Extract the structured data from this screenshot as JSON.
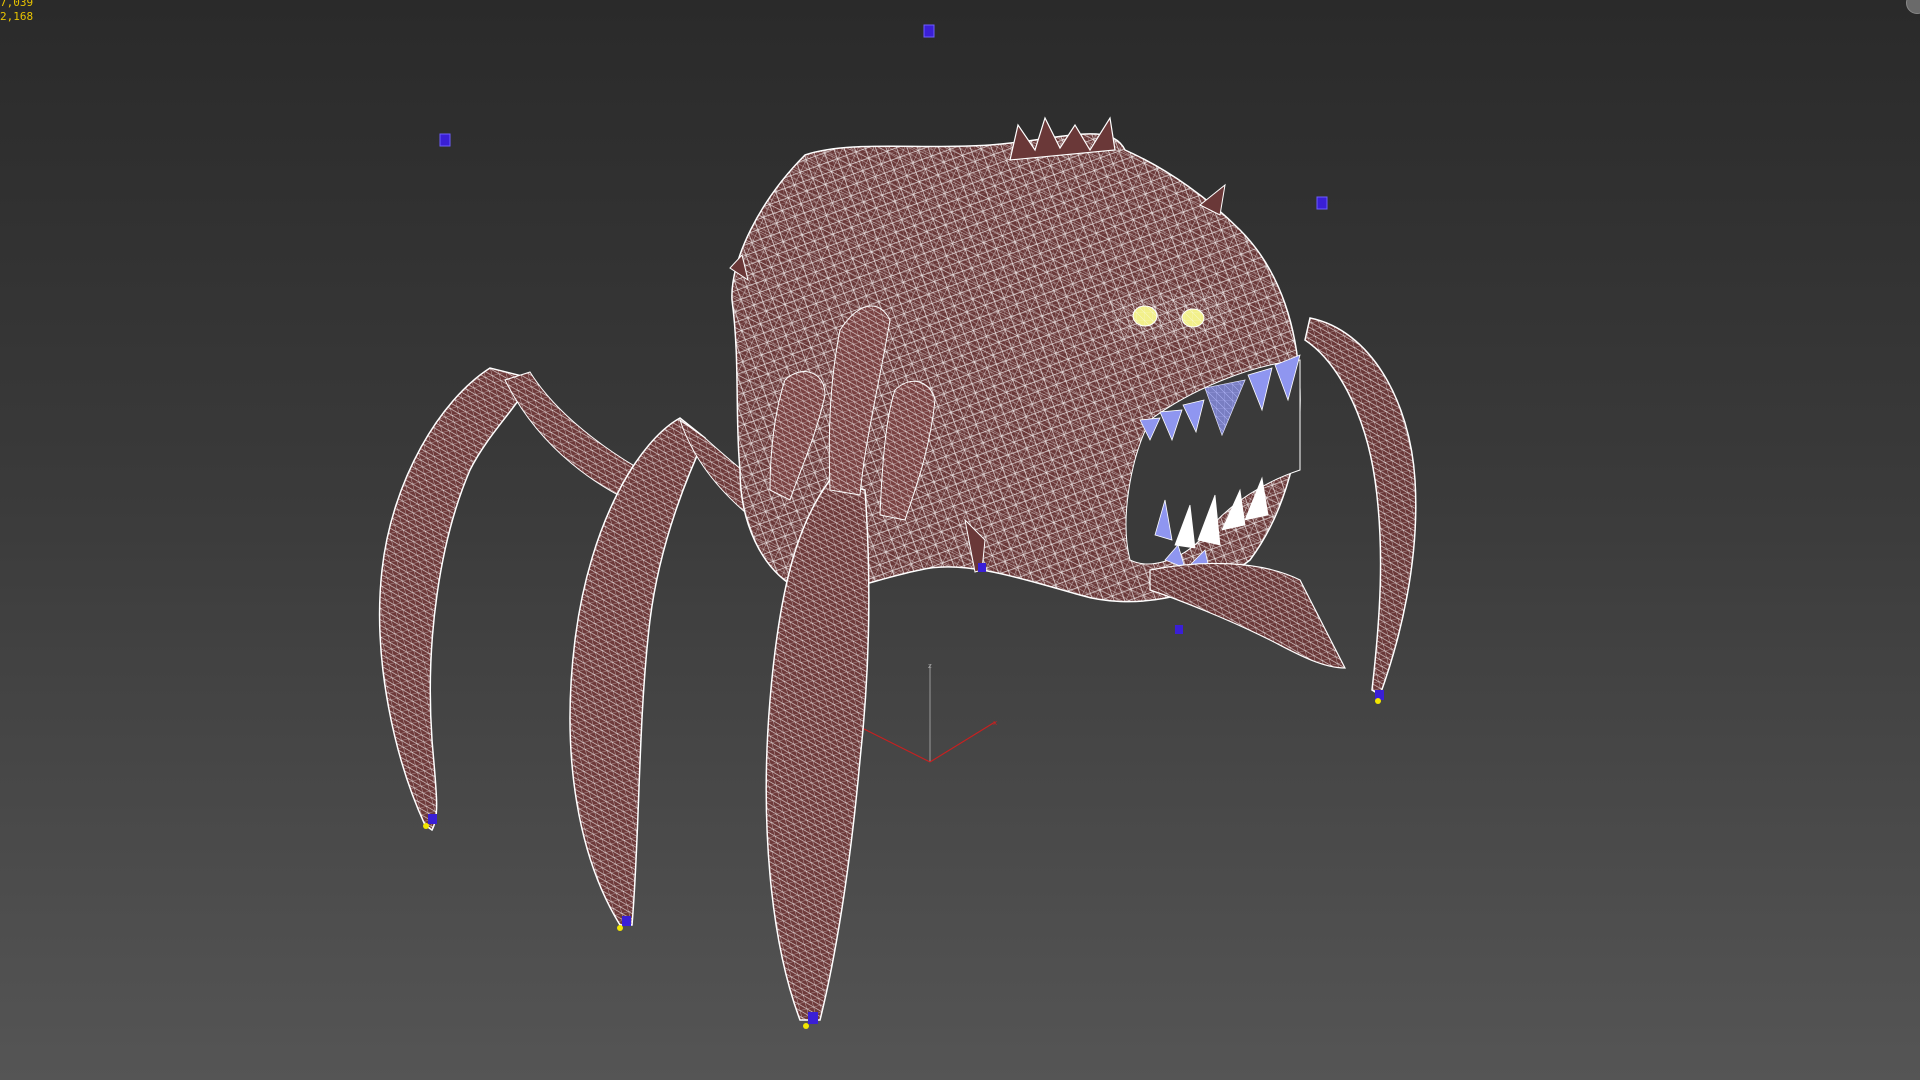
{
  "viewport": {
    "stats": {
      "line1": "7,039",
      "line2": "2,168"
    },
    "colors": {
      "background_top": "#2a2a2a",
      "background_bottom": "#555555",
      "mesh_fill": "#6e3a3a",
      "wire": "#ffffff",
      "helper": "#3a1fd6",
      "eye": "#f2f08a",
      "teeth": "#8f96f0",
      "gizmo": "#c82020",
      "stats_text": "#e8c300"
    },
    "icons": {
      "viewcube": "viewcube-icon",
      "gizmo": "transform-gizmo-icon"
    },
    "gizmo_axes": {
      "z": "z",
      "x": "x"
    }
  }
}
